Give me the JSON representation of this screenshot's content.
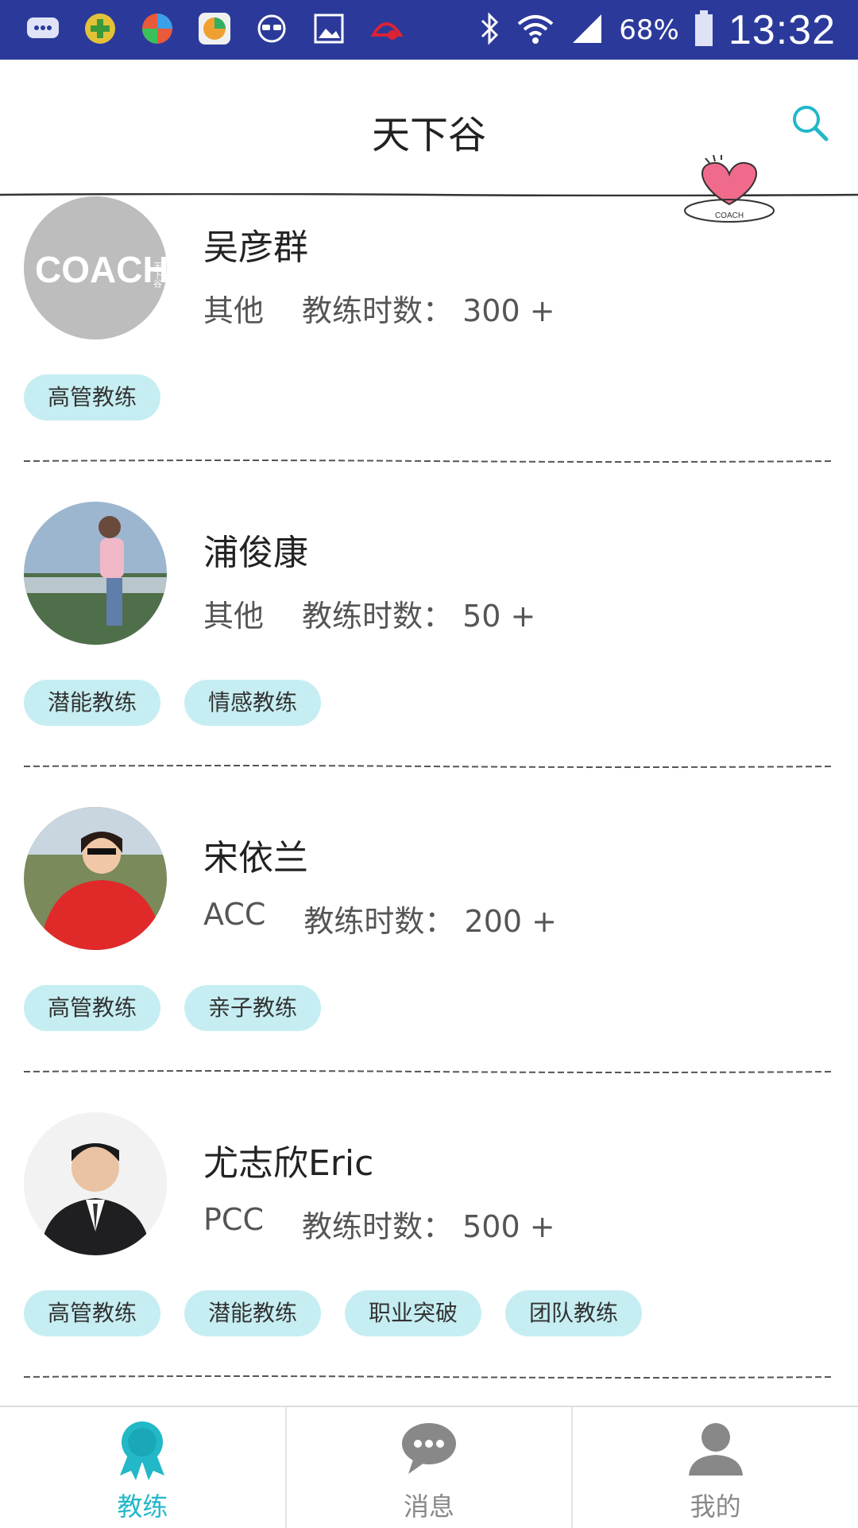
{
  "status_bar": {
    "battery": "68%",
    "time": "13:32",
    "bg_color": "#2b3a9a"
  },
  "header": {
    "title": "天下谷"
  },
  "coaches": [
    {
      "name": "吴彦群",
      "cert": "其他",
      "hours_label": "教练时数：",
      "hours": "300 +",
      "tags": [
        "高管教练"
      ]
    },
    {
      "name": "浦俊康",
      "cert": "其他",
      "hours_label": "教练时数：",
      "hours": "50 +",
      "tags": [
        "潜能教练",
        "情感教练"
      ]
    },
    {
      "name": "宋依兰",
      "cert": "ACC",
      "hours_label": "教练时数：",
      "hours": "200 +",
      "tags": [
        "高管教练",
        "亲子教练"
      ]
    },
    {
      "name": "尤志欣Eric",
      "cert": "PCC",
      "hours_label": "教练时数：",
      "hours": "500 +",
      "tags": [
        "高管教练",
        "潜能教练",
        "职业突破",
        "团队教练"
      ]
    }
  ],
  "avatar_logo": {
    "main": "COACH",
    "side": "天下谷"
  },
  "badge_text": "COACH",
  "bottom_nav": [
    {
      "label": "教练",
      "active": true
    },
    {
      "label": "消息",
      "active": false
    },
    {
      "label": "我的",
      "active": false
    }
  ],
  "colors": {
    "accent": "#22b8c8",
    "tag_bg": "#c6eef2",
    "inactive": "#888888"
  }
}
